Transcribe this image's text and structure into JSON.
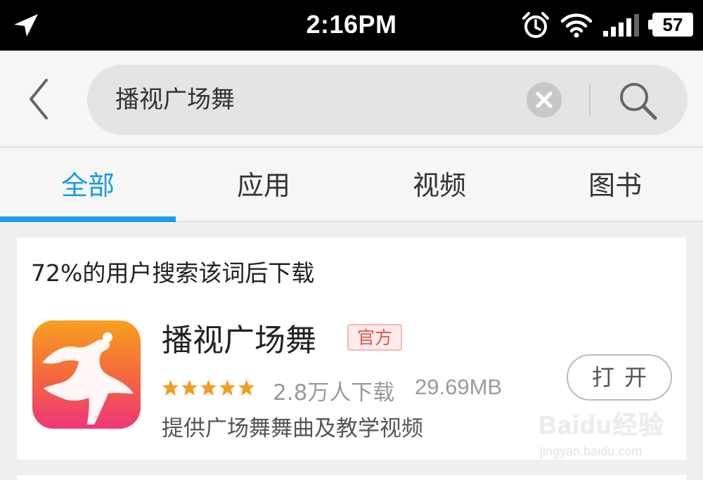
{
  "status_bar": {
    "time": "2:16PM",
    "battery": "57",
    "icons": [
      "location-arrow-icon",
      "alarm-clock-icon",
      "wifi-icon",
      "signal-bars-icon",
      "battery-icon"
    ]
  },
  "search": {
    "query": "播视广场舞",
    "back_icon": "chevron-left-icon",
    "clear_icon": "clear-circle-icon",
    "search_icon": "magnifier-icon"
  },
  "tabs": [
    {
      "label": "全部",
      "active": true
    },
    {
      "label": "应用",
      "active": false
    },
    {
      "label": "视频",
      "active": false
    },
    {
      "label": "图书",
      "active": false
    }
  ],
  "result_card": {
    "title": "72%的用户搜索该词后下载",
    "app": {
      "name": "播视广场舞",
      "badge": "官方",
      "rating": 5,
      "downloads": "2.8万人下载",
      "size": "29.69MB",
      "description": "提供广场舞舞曲及教学视频",
      "action_label": "打开",
      "icon": "dancer-app-icon"
    }
  },
  "watermark": {
    "text": "Baidu经验",
    "sub": "jingyan.baidu.com"
  },
  "colors": {
    "accent": "#1a9de1",
    "star": "#f39c1f",
    "badge_text": "#e8524f",
    "icon_gradient_top": "#f7a01f",
    "icon_gradient_bottom": "#f0357a"
  }
}
